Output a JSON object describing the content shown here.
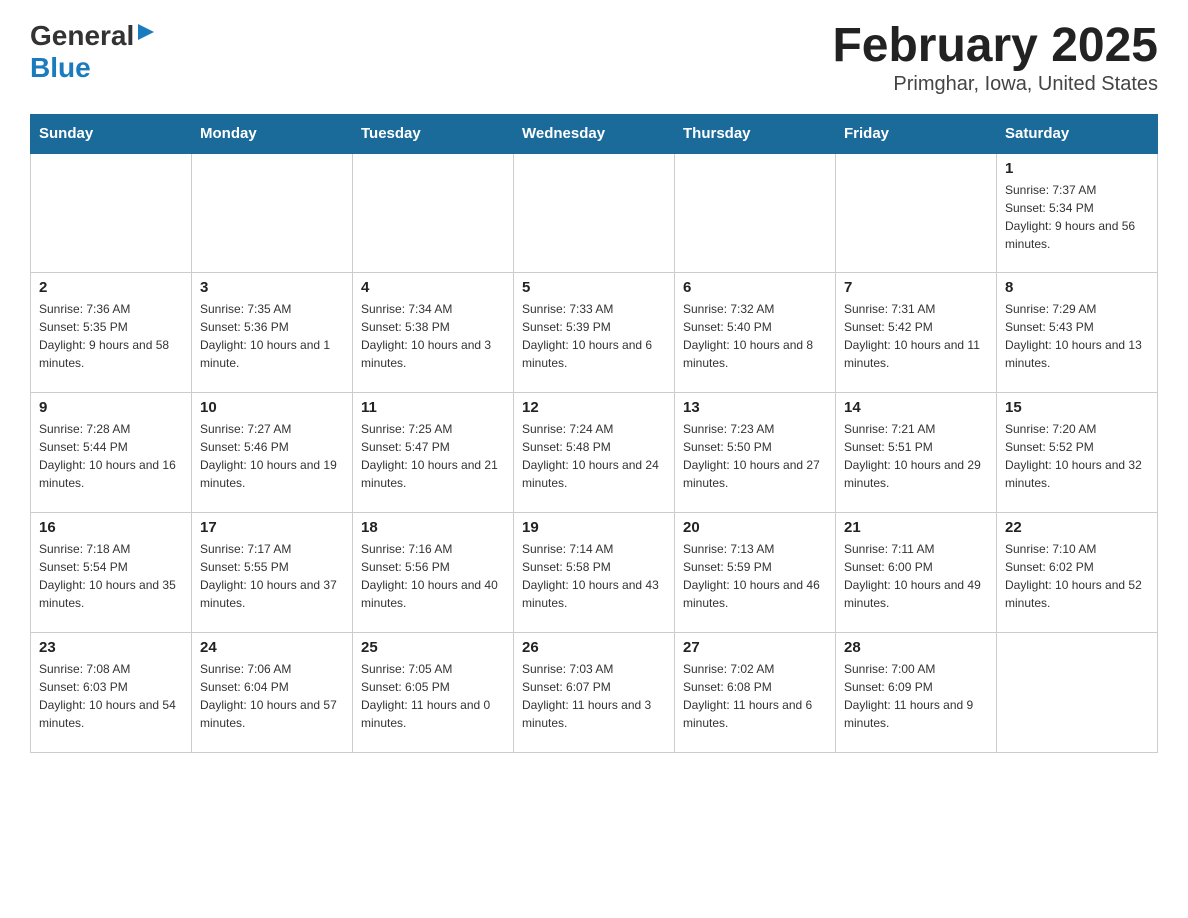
{
  "header": {
    "logo_general": "General",
    "logo_blue": "Blue",
    "title": "February 2025",
    "subtitle": "Primghar, Iowa, United States"
  },
  "weekdays": [
    "Sunday",
    "Monday",
    "Tuesday",
    "Wednesday",
    "Thursday",
    "Friday",
    "Saturday"
  ],
  "weeks": [
    [
      {
        "day": "",
        "sunrise": "",
        "sunset": "",
        "daylight": "",
        "empty": true
      },
      {
        "day": "",
        "sunrise": "",
        "sunset": "",
        "daylight": "",
        "empty": true
      },
      {
        "day": "",
        "sunrise": "",
        "sunset": "",
        "daylight": "",
        "empty": true
      },
      {
        "day": "",
        "sunrise": "",
        "sunset": "",
        "daylight": "",
        "empty": true
      },
      {
        "day": "",
        "sunrise": "",
        "sunset": "",
        "daylight": "",
        "empty": true
      },
      {
        "day": "",
        "sunrise": "",
        "sunset": "",
        "daylight": "",
        "empty": true
      },
      {
        "day": "1",
        "sunrise": "Sunrise: 7:37 AM",
        "sunset": "Sunset: 5:34 PM",
        "daylight": "Daylight: 9 hours and 56 minutes.",
        "empty": false
      }
    ],
    [
      {
        "day": "2",
        "sunrise": "Sunrise: 7:36 AM",
        "sunset": "Sunset: 5:35 PM",
        "daylight": "Daylight: 9 hours and 58 minutes.",
        "empty": false
      },
      {
        "day": "3",
        "sunrise": "Sunrise: 7:35 AM",
        "sunset": "Sunset: 5:36 PM",
        "daylight": "Daylight: 10 hours and 1 minute.",
        "empty": false
      },
      {
        "day": "4",
        "sunrise": "Sunrise: 7:34 AM",
        "sunset": "Sunset: 5:38 PM",
        "daylight": "Daylight: 10 hours and 3 minutes.",
        "empty": false
      },
      {
        "day": "5",
        "sunrise": "Sunrise: 7:33 AM",
        "sunset": "Sunset: 5:39 PM",
        "daylight": "Daylight: 10 hours and 6 minutes.",
        "empty": false
      },
      {
        "day": "6",
        "sunrise": "Sunrise: 7:32 AM",
        "sunset": "Sunset: 5:40 PM",
        "daylight": "Daylight: 10 hours and 8 minutes.",
        "empty": false
      },
      {
        "day": "7",
        "sunrise": "Sunrise: 7:31 AM",
        "sunset": "Sunset: 5:42 PM",
        "daylight": "Daylight: 10 hours and 11 minutes.",
        "empty": false
      },
      {
        "day": "8",
        "sunrise": "Sunrise: 7:29 AM",
        "sunset": "Sunset: 5:43 PM",
        "daylight": "Daylight: 10 hours and 13 minutes.",
        "empty": false
      }
    ],
    [
      {
        "day": "9",
        "sunrise": "Sunrise: 7:28 AM",
        "sunset": "Sunset: 5:44 PM",
        "daylight": "Daylight: 10 hours and 16 minutes.",
        "empty": false
      },
      {
        "day": "10",
        "sunrise": "Sunrise: 7:27 AM",
        "sunset": "Sunset: 5:46 PM",
        "daylight": "Daylight: 10 hours and 19 minutes.",
        "empty": false
      },
      {
        "day": "11",
        "sunrise": "Sunrise: 7:25 AM",
        "sunset": "Sunset: 5:47 PM",
        "daylight": "Daylight: 10 hours and 21 minutes.",
        "empty": false
      },
      {
        "day": "12",
        "sunrise": "Sunrise: 7:24 AM",
        "sunset": "Sunset: 5:48 PM",
        "daylight": "Daylight: 10 hours and 24 minutes.",
        "empty": false
      },
      {
        "day": "13",
        "sunrise": "Sunrise: 7:23 AM",
        "sunset": "Sunset: 5:50 PM",
        "daylight": "Daylight: 10 hours and 27 minutes.",
        "empty": false
      },
      {
        "day": "14",
        "sunrise": "Sunrise: 7:21 AM",
        "sunset": "Sunset: 5:51 PM",
        "daylight": "Daylight: 10 hours and 29 minutes.",
        "empty": false
      },
      {
        "day": "15",
        "sunrise": "Sunrise: 7:20 AM",
        "sunset": "Sunset: 5:52 PM",
        "daylight": "Daylight: 10 hours and 32 minutes.",
        "empty": false
      }
    ],
    [
      {
        "day": "16",
        "sunrise": "Sunrise: 7:18 AM",
        "sunset": "Sunset: 5:54 PM",
        "daylight": "Daylight: 10 hours and 35 minutes.",
        "empty": false
      },
      {
        "day": "17",
        "sunrise": "Sunrise: 7:17 AM",
        "sunset": "Sunset: 5:55 PM",
        "daylight": "Daylight: 10 hours and 37 minutes.",
        "empty": false
      },
      {
        "day": "18",
        "sunrise": "Sunrise: 7:16 AM",
        "sunset": "Sunset: 5:56 PM",
        "daylight": "Daylight: 10 hours and 40 minutes.",
        "empty": false
      },
      {
        "day": "19",
        "sunrise": "Sunrise: 7:14 AM",
        "sunset": "Sunset: 5:58 PM",
        "daylight": "Daylight: 10 hours and 43 minutes.",
        "empty": false
      },
      {
        "day": "20",
        "sunrise": "Sunrise: 7:13 AM",
        "sunset": "Sunset: 5:59 PM",
        "daylight": "Daylight: 10 hours and 46 minutes.",
        "empty": false
      },
      {
        "day": "21",
        "sunrise": "Sunrise: 7:11 AM",
        "sunset": "Sunset: 6:00 PM",
        "daylight": "Daylight: 10 hours and 49 minutes.",
        "empty": false
      },
      {
        "day": "22",
        "sunrise": "Sunrise: 7:10 AM",
        "sunset": "Sunset: 6:02 PM",
        "daylight": "Daylight: 10 hours and 52 minutes.",
        "empty": false
      }
    ],
    [
      {
        "day": "23",
        "sunrise": "Sunrise: 7:08 AM",
        "sunset": "Sunset: 6:03 PM",
        "daylight": "Daylight: 10 hours and 54 minutes.",
        "empty": false
      },
      {
        "day": "24",
        "sunrise": "Sunrise: 7:06 AM",
        "sunset": "Sunset: 6:04 PM",
        "daylight": "Daylight: 10 hours and 57 minutes.",
        "empty": false
      },
      {
        "day": "25",
        "sunrise": "Sunrise: 7:05 AM",
        "sunset": "Sunset: 6:05 PM",
        "daylight": "Daylight: 11 hours and 0 minutes.",
        "empty": false
      },
      {
        "day": "26",
        "sunrise": "Sunrise: 7:03 AM",
        "sunset": "Sunset: 6:07 PM",
        "daylight": "Daylight: 11 hours and 3 minutes.",
        "empty": false
      },
      {
        "day": "27",
        "sunrise": "Sunrise: 7:02 AM",
        "sunset": "Sunset: 6:08 PM",
        "daylight": "Daylight: 11 hours and 6 minutes.",
        "empty": false
      },
      {
        "day": "28",
        "sunrise": "Sunrise: 7:00 AM",
        "sunset": "Sunset: 6:09 PM",
        "daylight": "Daylight: 11 hours and 9 minutes.",
        "empty": false
      },
      {
        "day": "",
        "sunrise": "",
        "sunset": "",
        "daylight": "",
        "empty": true
      }
    ]
  ]
}
